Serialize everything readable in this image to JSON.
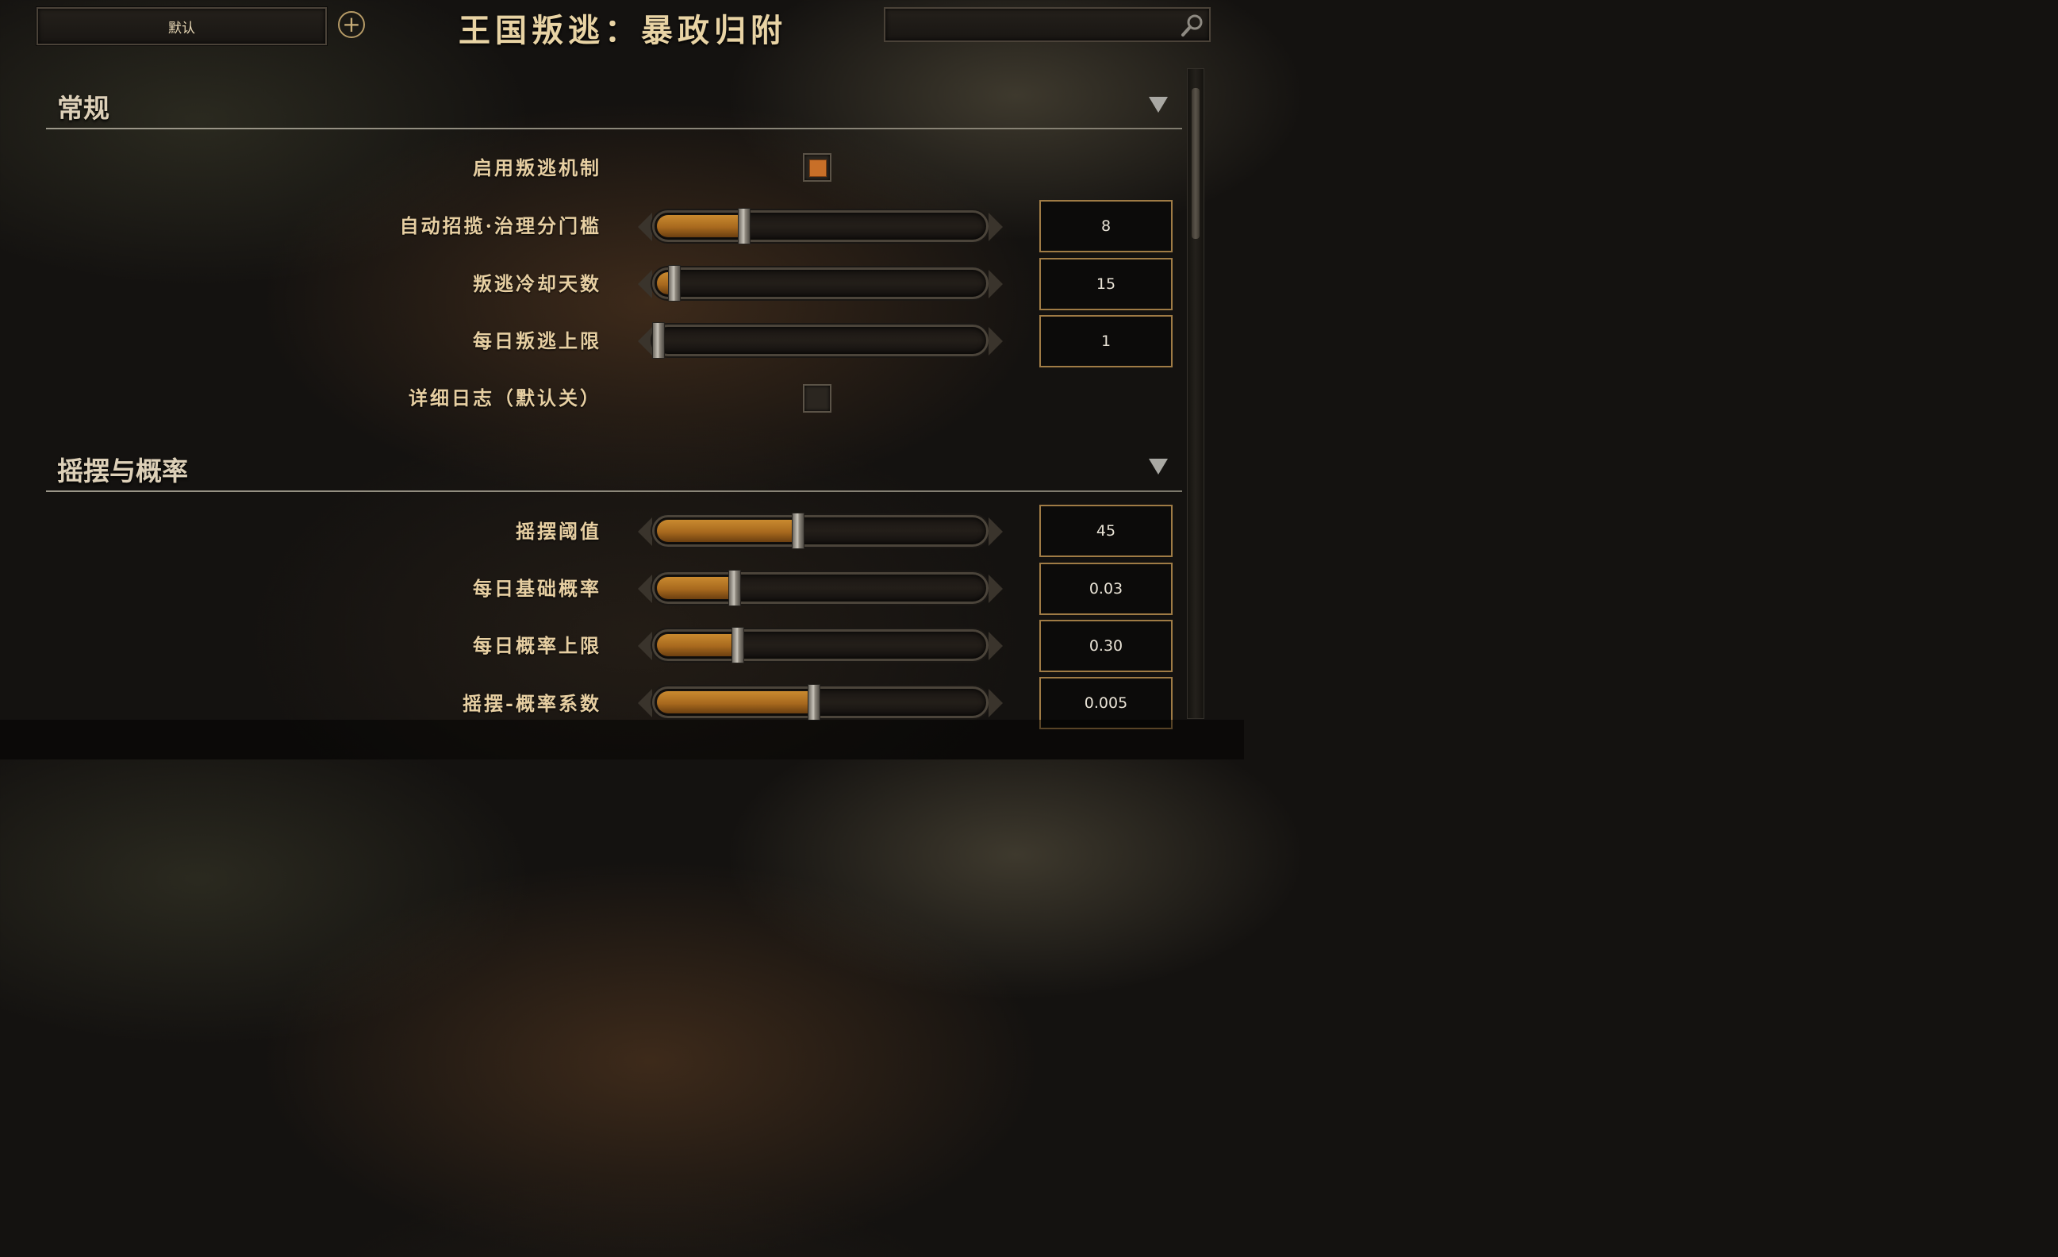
{
  "header": {
    "preset_label": "默认",
    "title": "王国叛逃：暴政归附",
    "search_placeholder": ""
  },
  "sections": [
    {
      "title": "常规"
    },
    {
      "title": "摇摆与概率"
    }
  ],
  "settings": {
    "enable_defection": {
      "label": "启用叛逃机制",
      "checked": true
    },
    "auto_recruit_threshold": {
      "label": "自动招揽·治理分门槛",
      "value": "8",
      "fraction": 0.27
    },
    "defection_cooldown_days": {
      "label": "叛逃冷却天数",
      "value": "15",
      "fraction": 0.05
    },
    "daily_defection_limit": {
      "label": "每日叛逃上限",
      "value": "1",
      "fraction": 0.0
    },
    "verbose_log": {
      "label": "详细日志（默认关）",
      "checked": false
    },
    "sway_threshold": {
      "label": "摇摆阈值",
      "value": "45",
      "fraction": 0.44
    },
    "daily_base_probability": {
      "label": "每日基础概率",
      "value": "0.03",
      "fraction": 0.24
    },
    "daily_probability_cap": {
      "label": "每日概率上限",
      "value": "0.30",
      "fraction": 0.25
    },
    "sway_probability_factor": {
      "label": "摇摆-概率系数",
      "value": "0.005",
      "fraction": 0.49
    }
  },
  "colors": {
    "accent": "#c86f28",
    "slider_fill": "#b8782a",
    "value_border": "#9f7b45",
    "label_text": "#e7cfa2"
  },
  "icons": {
    "add": "plus-circle-icon",
    "search": "magnifier-icon",
    "collapse": "triangle-down-icon"
  }
}
